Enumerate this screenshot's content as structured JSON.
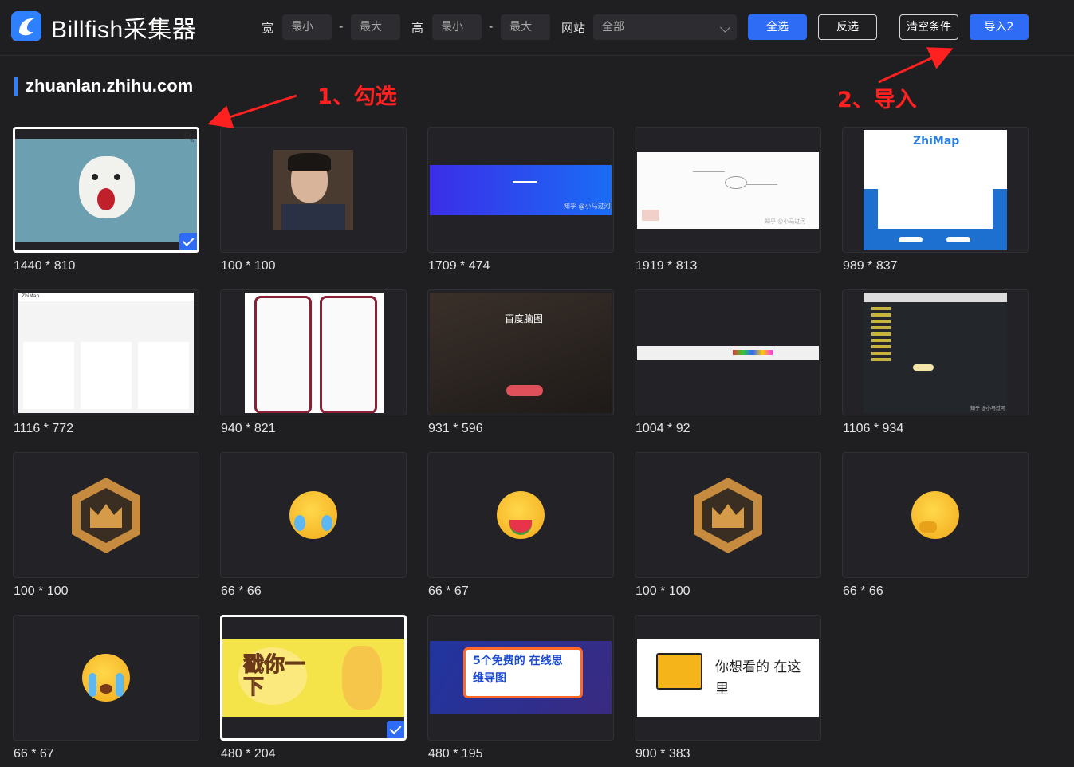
{
  "app": {
    "name": "Billfish采集器"
  },
  "filters": {
    "width_label": "宽",
    "width_min": "最小",
    "width_max": "最大",
    "height_label": "高",
    "height_min": "最小",
    "height_max": "最大",
    "dash": "-",
    "site_label": "网站",
    "site_value": "全部"
  },
  "buttons": {
    "select_all": "全选",
    "invert": "反选",
    "clear": "清空条件",
    "import": "导入2"
  },
  "site_title": "zhuanlan.zhihu.com",
  "annotations": {
    "step1": "1、勾选",
    "step2": "2、导入"
  },
  "images": [
    {
      "dim": "1440 * 810",
      "selected": true,
      "thumb_text": ""
    },
    {
      "dim": "100 * 100",
      "selected": false,
      "thumb_text": ""
    },
    {
      "dim": "1709 * 474",
      "selected": false,
      "thumb_text": "知乎 @小马过河"
    },
    {
      "dim": "1919 * 813",
      "selected": false,
      "thumb_text": "知乎 @小马过河"
    },
    {
      "dim": "989 * 837",
      "selected": false,
      "thumb_text": "ZhiMap"
    },
    {
      "dim": "1116 * 772",
      "selected": false,
      "thumb_text": "ZhiMap"
    },
    {
      "dim": "940 * 821",
      "selected": false,
      "thumb_text": ""
    },
    {
      "dim": "931 * 596",
      "selected": false,
      "thumb_text": "百度脑图"
    },
    {
      "dim": "1004 * 92",
      "selected": false,
      "thumb_text": ""
    },
    {
      "dim": "1106 * 934",
      "selected": false,
      "thumb_text": "知乎 @小马过河"
    },
    {
      "dim": "100 * 100",
      "selected": false,
      "thumb_text": ""
    },
    {
      "dim": "66 * 66",
      "selected": false,
      "thumb_text": ""
    },
    {
      "dim": "66 * 67",
      "selected": false,
      "thumb_text": ""
    },
    {
      "dim": "100 * 100",
      "selected": false,
      "thumb_text": ""
    },
    {
      "dim": "66 * 66",
      "selected": false,
      "thumb_text": ""
    },
    {
      "dim": "66 * 67",
      "selected": false,
      "thumb_text": ""
    },
    {
      "dim": "480 * 204",
      "selected": true,
      "thumb_text": "戳你一下"
    },
    {
      "dim": "480 * 195",
      "selected": false,
      "thumb_text": "5个免费的 在线思维导图"
    },
    {
      "dim": "900 * 383",
      "selected": false,
      "thumb_text": "你想看的 在这里"
    }
  ],
  "colors": {
    "accent": "#2f6cf5",
    "background": "#1f1f22",
    "annotation": "#ff2020"
  }
}
